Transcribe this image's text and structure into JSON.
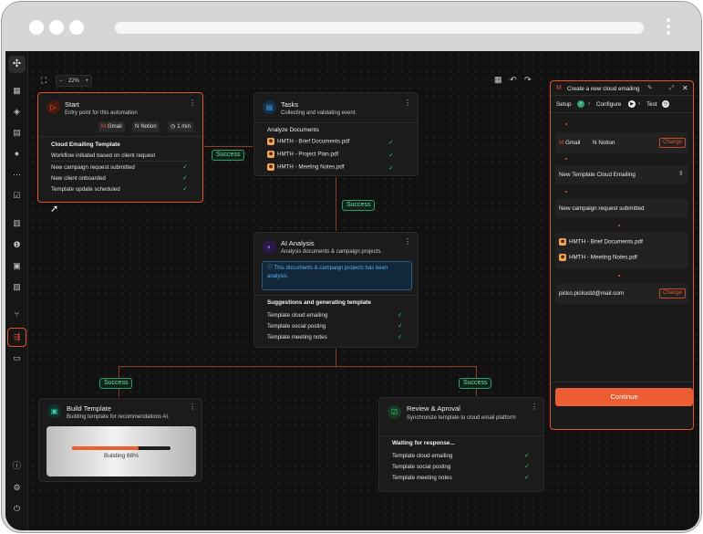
{
  "toolbar": {
    "zoom": "22%",
    "zoom_minus": "−",
    "zoom_plus": "+"
  },
  "start": {
    "title": "Start",
    "subtitle": "Entry point for this automation",
    "tags": [
      "Gmail",
      "Notion",
      "1 min"
    ],
    "heading": "Cloud Emailing Template",
    "desc": "Workflow initiated based on client request",
    "items": [
      "New campaign request submitted",
      "New client onboarded",
      "Template update scheduled"
    ]
  },
  "tasks": {
    "title": "Tasks",
    "subtitle": "Collecting and validating event.",
    "heading": "Analyze Documents",
    "items": [
      "HMTH - Brief Documents.pdf",
      "HMTH - Project Plan.pdf",
      "HMTH - Meeting Notes.pdf"
    ]
  },
  "ai": {
    "title": "AI Analysis",
    "subtitle": "Analysis documents & campaign projects.",
    "info": "This documents & campaign projects has been analysis.",
    "heading": "Suggestions and generating template",
    "items": [
      "Template cloud emailing",
      "Template social posting",
      "Template meeting notes"
    ]
  },
  "build": {
    "title": "Build Template",
    "subtitle": "Building template for recommendations AI.",
    "progress_label": "Building 68%",
    "progress": 0.68
  },
  "review": {
    "title": "Review & Aproval",
    "subtitle": "Synchronize template to cloud email platform",
    "heading": "Waiting for response...",
    "items": [
      "Template cloud emailing",
      "Template social posting",
      "Template meeting notes"
    ]
  },
  "badges": {
    "success": "Success"
  },
  "panel": {
    "title": "Create a new cloud emailing",
    "steps": [
      "Setup",
      "Configure",
      "Test"
    ],
    "apps": [
      "Gmail",
      "Notion"
    ],
    "change": "Change",
    "template": "New Template Cloud Emailing",
    "trigger": "New campaign request submitted",
    "files": [
      "HMTH - Brief Documents.pdf",
      "HMTH - Meeting Notes.pdf"
    ],
    "email": "picko.pickostd@mail.com",
    "continue": "Continue"
  },
  "colors": {
    "accent": "#e2532d",
    "success": "#33c46a",
    "info": "#5ab0f0"
  }
}
